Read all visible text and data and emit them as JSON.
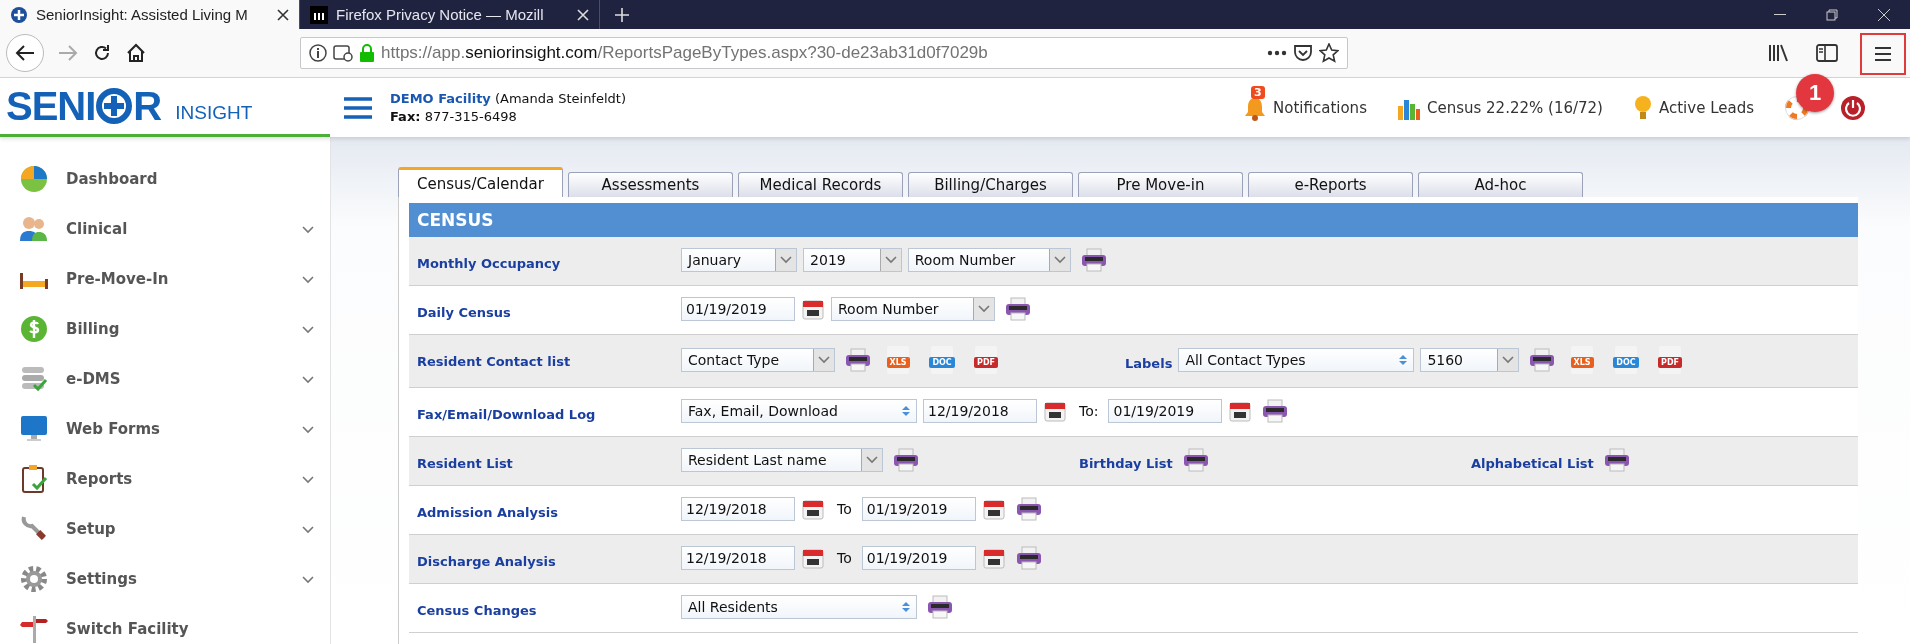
{
  "browser": {
    "tabs": [
      {
        "title": "SeniorInsight: Assisted Living M",
        "selected": true
      },
      {
        "title": "Firefox Privacy Notice — Mozill",
        "selected": false
      }
    ],
    "url": {
      "scheme": "https://app.",
      "domain": "seniorinsight.com",
      "path": "/ReportsPageByTypes.aspx?30-de23ab31d0f7029b"
    },
    "callout": "1"
  },
  "header": {
    "logo": {
      "before": "SENI",
      "after": "R",
      "subtitle": "INSIGHT"
    },
    "facility": {
      "name": "DEMO Facility",
      "user": "(Amanda Steinfeldt)",
      "fax_label": "Fax:",
      "fax": "877-315-6498"
    },
    "links": [
      {
        "kind": "notifications",
        "label": "Notifications",
        "badge": "3"
      },
      {
        "kind": "census",
        "label": "Census 22.22% (16/72)"
      },
      {
        "kind": "leads",
        "label": "Active Leads"
      },
      {
        "kind": "help"
      },
      {
        "kind": "power"
      }
    ]
  },
  "sidebar": {
    "items": [
      {
        "label": "Dashboard",
        "expandable": false
      },
      {
        "label": "Clinical",
        "expandable": true
      },
      {
        "label": "Pre-Move-In",
        "expandable": true
      },
      {
        "label": "Billing",
        "expandable": true
      },
      {
        "label": "e-DMS",
        "expandable": true
      },
      {
        "label": "Web Forms",
        "expandable": true
      },
      {
        "label": "Reports",
        "expandable": true
      },
      {
        "label": "Setup",
        "expandable": true
      },
      {
        "label": "Settings",
        "expandable": true
      },
      {
        "label": "Switch Facility",
        "expandable": false
      }
    ]
  },
  "tabs": [
    {
      "label": "Census/Calendar",
      "selected": true
    },
    {
      "label": "Assessments",
      "selected": false
    },
    {
      "label": "Medical Records",
      "selected": false
    },
    {
      "label": "Billing/Charges",
      "selected": false
    },
    {
      "label": "Pre Move-in",
      "selected": false
    },
    {
      "label": "e-Reports",
      "selected": false
    },
    {
      "label": "Ad-hoc",
      "selected": false
    }
  ],
  "section": {
    "title": "CENSUS",
    "rows": [
      {
        "label": "Monthly Occupancy",
        "groups": [
          [
            {
              "kind": "combo",
              "value": "January"
            },
            {
              "kind": "combo",
              "value": "2019"
            },
            {
              "kind": "combo",
              "value": "Room Number"
            },
            {
              "kind": "print"
            }
          ]
        ]
      },
      {
        "label": "Daily Census",
        "groups": [
          [
            {
              "kind": "date",
              "value": "01/19/2019"
            },
            {
              "kind": "calendar"
            },
            {
              "kind": "combo",
              "value": "Room Number"
            },
            {
              "kind": "print"
            }
          ]
        ]
      },
      {
        "label": "Resident Contact list",
        "groups": [
          [
            {
              "kind": "combo",
              "value": "Contact Type"
            },
            {
              "kind": "print"
            },
            {
              "kind": "file",
              "label": "XLS",
              "color": "#e8601c"
            },
            {
              "kind": "file",
              "label": "DOC",
              "color": "#2a86d6"
            },
            {
              "kind": "file",
              "label": "PDF",
              "color": "#c62a2a"
            }
          ],
          [
            {
              "kind": "link",
              "label": "Labels"
            },
            {
              "kind": "spinner",
              "value": "All Contact Types"
            },
            {
              "kind": "combo",
              "value": "5160"
            },
            {
              "kind": "print"
            },
            {
              "kind": "file",
              "label": "XLS",
              "color": "#e8601c"
            },
            {
              "kind": "file",
              "label": "DOC",
              "color": "#2a86d6"
            },
            {
              "kind": "file",
              "label": "PDF",
              "color": "#c62a2a"
            }
          ]
        ]
      },
      {
        "label": "Fax/Email/Download Log",
        "groups": [
          [
            {
              "kind": "spinner",
              "value": "Fax, Email, Download"
            },
            {
              "kind": "date",
              "value": "12/19/2018"
            },
            {
              "kind": "calendar"
            },
            {
              "kind": "text",
              "label": "To:"
            },
            {
              "kind": "date",
              "value": "01/19/2019"
            },
            {
              "kind": "calendar"
            },
            {
              "kind": "print"
            }
          ]
        ]
      },
      {
        "label": "Resident List",
        "groups": [
          [
            {
              "kind": "combo",
              "value": "Resident Last name"
            },
            {
              "kind": "print"
            }
          ],
          [
            {
              "kind": "link",
              "label": "Birthday List"
            },
            {
              "kind": "print"
            }
          ],
          [
            {
              "kind": "link",
              "label": "Alphabetical List"
            },
            {
              "kind": "print"
            }
          ]
        ]
      },
      {
        "label": "Admission Analysis",
        "groups": [
          [
            {
              "kind": "date",
              "value": "12/19/2018"
            },
            {
              "kind": "calendar"
            },
            {
              "kind": "text",
              "label": "To"
            },
            {
              "kind": "date",
              "value": "01/19/2019"
            },
            {
              "kind": "calendar"
            },
            {
              "kind": "print"
            }
          ]
        ]
      },
      {
        "label": "Discharge Analysis",
        "groups": [
          [
            {
              "kind": "date",
              "value": "12/19/2018"
            },
            {
              "kind": "calendar"
            },
            {
              "kind": "text",
              "label": "To"
            },
            {
              "kind": "date",
              "value": "01/19/2019"
            },
            {
              "kind": "calendar"
            },
            {
              "kind": "print"
            }
          ]
        ]
      },
      {
        "label": "Census Changes",
        "groups": [
          [
            {
              "kind": "spinner",
              "value": "All Residents"
            },
            {
              "kind": "print"
            }
          ]
        ]
      }
    ]
  }
}
